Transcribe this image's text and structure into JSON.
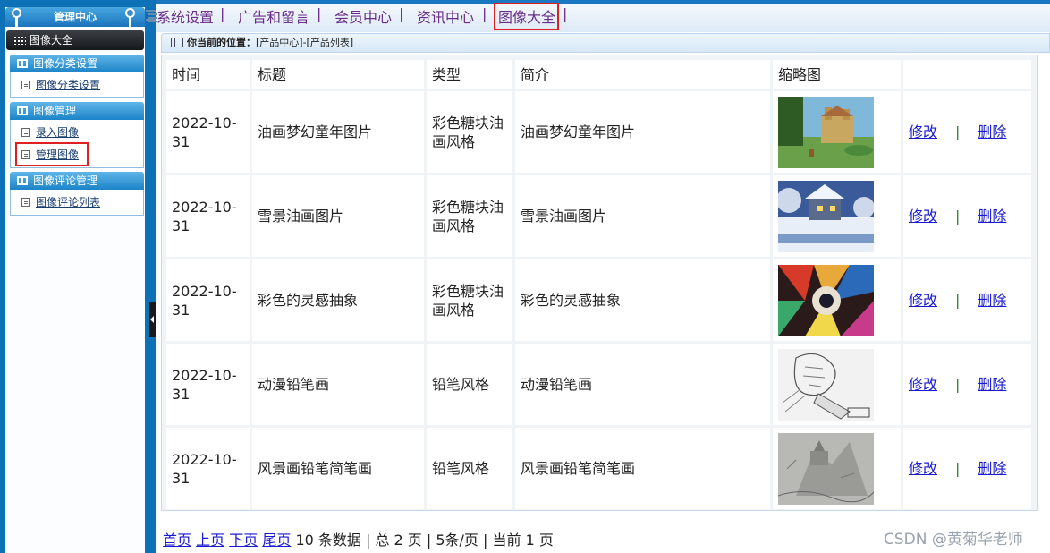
{
  "sidebar": {
    "header": "管理中心",
    "current": "图像大全",
    "groups": [
      {
        "title": "图像分类设置",
        "links": [
          "图像分类设置"
        ]
      },
      {
        "title": "图像管理",
        "links": [
          "录入图像",
          "管理图像"
        ]
      },
      {
        "title": "图像评论管理",
        "links": [
          "图像评论列表"
        ]
      }
    ]
  },
  "topnav": {
    "items": [
      "系统设置",
      "广告和留言",
      "会员中心",
      "资讯中心",
      "图像大全"
    ],
    "separator": "|",
    "active": "图像大全"
  },
  "breadcrumb": {
    "label": "你当前的位置：",
    "path": "[产品中心]-[产品列表]"
  },
  "table": {
    "headers": [
      "时间",
      "标题",
      "类型",
      "简介",
      "缩略图",
      ""
    ],
    "rows": [
      {
        "time": "2022-10-31",
        "title": "油画梦幻童年图片",
        "type": "彩色糖块油画风格",
        "intro": "油画梦幻童年图片",
        "edit": "修改",
        "sep": "|",
        "delete": "删除",
        "thumb": "castle-painting-thumbnail"
      },
      {
        "time": "2022-10-31",
        "title": "雪景油画图片",
        "type": "彩色糖块油画风格",
        "intro": "雪景油画图片",
        "edit": "修改",
        "sep": "|",
        "delete": "删除",
        "thumb": "snow-landscape-thumbnail"
      },
      {
        "time": "2022-10-31",
        "title": "彩色的灵感抽象",
        "type": "彩色糖块油画风格",
        "intro": "彩色的灵感抽象",
        "edit": "修改",
        "sep": "|",
        "delete": "删除",
        "thumb": "abstract-color-thumbnail"
      },
      {
        "time": "2022-10-31",
        "title": "动漫铅笔画",
        "type": "铅笔风格",
        "intro": "动漫铅笔画",
        "edit": "修改",
        "sep": "|",
        "delete": "删除",
        "thumb": "anime-pencil-thumbnail"
      },
      {
        "time": "2022-10-31",
        "title": "风景画铅笔简笔画",
        "type": "铅笔风格",
        "intro": "风景画铅笔简笔画",
        "edit": "修改",
        "sep": "|",
        "delete": "删除",
        "thumb": "landscape-pencil-thumbnail"
      }
    ]
  },
  "pager": {
    "first": "首页",
    "prev": "上页",
    "next": "下页",
    "last": "尾页",
    "info": "10 条数据 | 总 2 页 | 5条/页 | 当前 1 页"
  },
  "watermark": "CSDN @黄菊华老师",
  "colors": {
    "frame_blue": "#0d71b8",
    "highlight_red": "#e02020",
    "link_blue": "#1a1ad0",
    "nav_purple": "#6a2e8a"
  }
}
